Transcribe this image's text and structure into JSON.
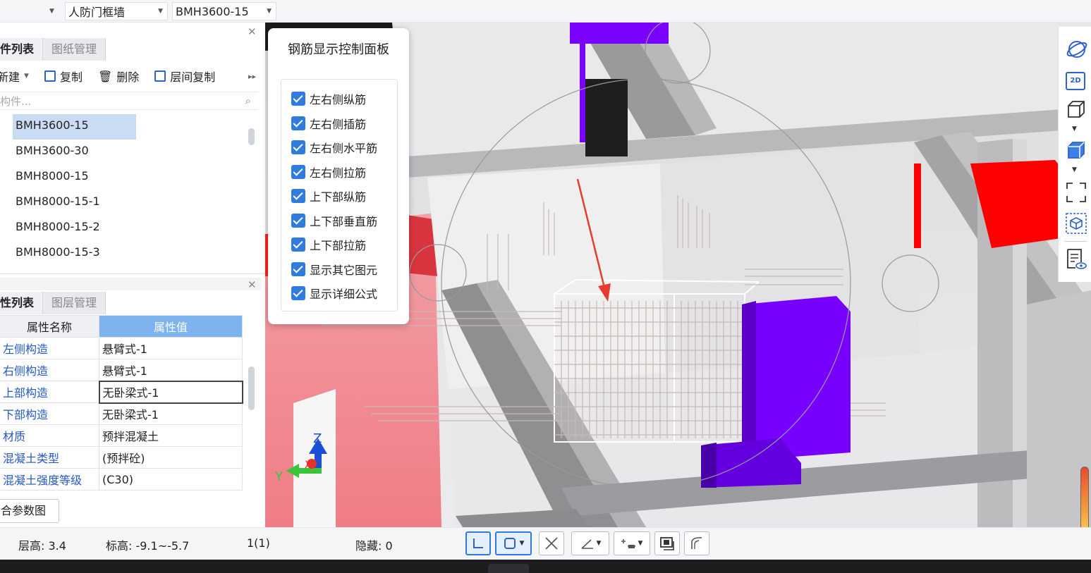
{
  "top_bar": {
    "selector_1": "人防门框墙",
    "selector_2": "BMH3600-15"
  },
  "component_panel": {
    "tabs": [
      "件列表",
      "图纸管理"
    ],
    "toolbar": {
      "new_label": "新建",
      "copy_label": "复制",
      "delete_label": "删除",
      "floor_copy_label": "层间复制"
    },
    "search_placeholder": "构件...",
    "items": [
      "BMH3600-15",
      "BMH3600-30",
      "BMH8000-15",
      "BMH8000-15-1",
      "BMH8000-15-2",
      "BMH8000-15-3"
    ],
    "selected_index": 0
  },
  "property_panel": {
    "tabs": [
      "性列表",
      "图层管理"
    ],
    "header_name": "属性名称",
    "header_value": "属性值",
    "rows": [
      {
        "name": "左侧构造",
        "value": "悬臂式-1"
      },
      {
        "name": "右侧构造",
        "value": "悬臂式-1"
      },
      {
        "name": "上部构造",
        "value": "无卧梁式-1"
      },
      {
        "name": "下部构造",
        "value": "无卧梁式-1"
      },
      {
        "name": "材质",
        "value": "预拌混凝土"
      },
      {
        "name": "混凝土类型",
        "value": "(预拌砼)"
      },
      {
        "name": "混凝土强度等级",
        "value": "(C30)"
      }
    ],
    "param_button": "合参数图"
  },
  "rebar_panel": {
    "title": "钢筋显示控制面板",
    "options": [
      {
        "label": "左右侧纵筋",
        "checked": true
      },
      {
        "label": "左右侧插筋",
        "checked": true
      },
      {
        "label": "左右侧水平筋",
        "checked": true
      },
      {
        "label": "左右侧拉筋",
        "checked": true
      },
      {
        "label": "上下部纵筋",
        "checked": true
      },
      {
        "label": "上下部垂直筋",
        "checked": true
      },
      {
        "label": "上下部拉筋",
        "checked": true
      },
      {
        "label": "显示其它图元",
        "checked": true
      },
      {
        "label": "显示详细公式",
        "checked": true
      }
    ]
  },
  "view_tools": {
    "mode_2d": "2D"
  },
  "axes": {
    "x": "X",
    "y": "Y",
    "z": "Z"
  },
  "status_bar": {
    "floor_height": "层高:  3.4",
    "elevation": "标高:  -9.1~-5.7",
    "count": "1(1)",
    "hidden": "隐藏:  0"
  },
  "colors": {
    "accent": "#2f7be0",
    "selection": "#c9dcf3",
    "purple_element": "#7a00ff",
    "red_element": "#ff0000"
  }
}
